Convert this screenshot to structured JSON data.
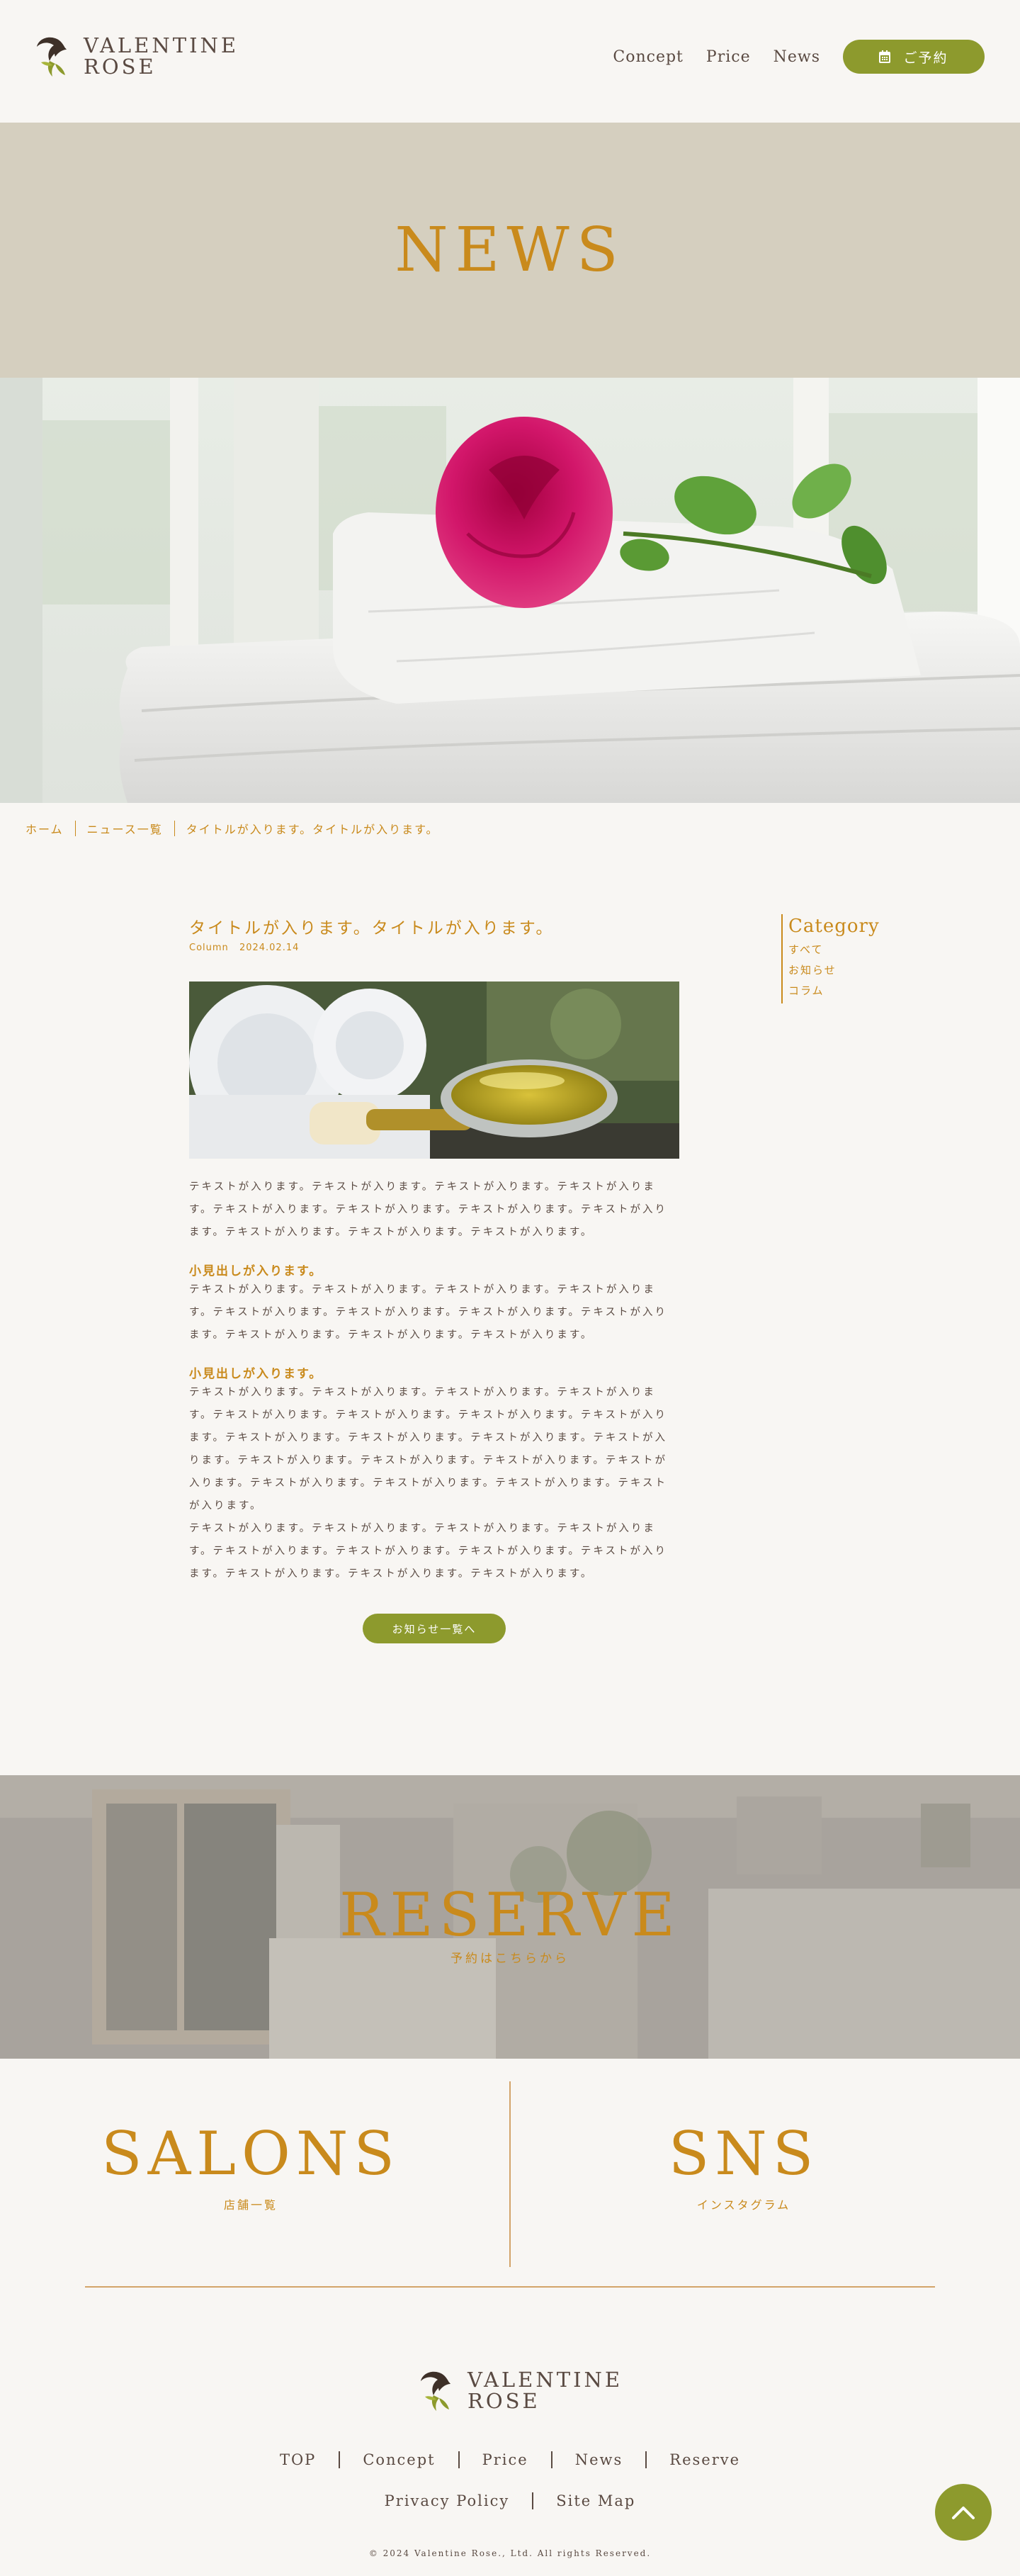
{
  "brand": {
    "line1": "VALENTINE",
    "line2": "ROSE"
  },
  "nav": {
    "items": [
      {
        "label": "Concept"
      },
      {
        "label": "Price"
      },
      {
        "label": "News"
      }
    ],
    "reserve_label": "ご予約"
  },
  "hero": {
    "title": "NEWS"
  },
  "breadcrumb": [
    "ホーム",
    "ニュース一覧",
    "タイトルが入ります。タイトルが入ります。"
  ],
  "article": {
    "title": "タイトルが入ります。タイトルが入ります。",
    "category": "Column",
    "date": "2024.02.14",
    "paragraph1": "テキストが入ります。テキストが入ります。テキストが入ります。テキストが入ります。テキストが入ります。テキストが入ります。テキストが入ります。テキストが入ります。テキストが入ります。テキストが入ります。テキストが入ります。",
    "subheading1": "小見出しが入ります。",
    "paragraph2": "テキストが入ります。テキストが入ります。テキストが入ります。テキストが入ります。テキストが入ります。テキストが入ります。テキストが入ります。テキストが入ります。テキストが入ります。テキストが入ります。テキストが入ります。",
    "subheading2": "小見出しが入ります。",
    "paragraph3": "テキストが入ります。テキストが入ります。テキストが入ります。テキストが入ります。テキストが入ります。テキストが入ります。テキストが入ります。テキストが入ります。テキストが入ります。テキストが入ります。テキストが入ります。テキストが入ります。テキストが入ります。テキストが入ります。テキストが入ります。テキストが入ります。テキストが入ります。テキストが入ります。テキストが入ります。テキストが入ります。",
    "paragraph4": "テキストが入ります。テキストが入ります。テキストが入ります。テキストが入ります。テキストが入ります。テキストが入ります。テキストが入ります。テキストが入ります。テキストが入ります。テキストが入ります。テキストが入ります。",
    "back_button": "お知らせ一覧へ"
  },
  "sidebar": {
    "title": "Category",
    "items": [
      "すべて",
      "お知らせ",
      "コラム"
    ]
  },
  "reserve": {
    "title": "RESERVE",
    "subtitle": "予約はこちらから"
  },
  "salons": {
    "title": "SALONS",
    "subtitle": "店舗一覧"
  },
  "sns": {
    "title": "SNS",
    "subtitle": "インスタグラム"
  },
  "footer": {
    "nav1": [
      "TOP",
      "Concept",
      "Price",
      "News",
      "Reserve"
    ],
    "nav2": [
      "Privacy Policy",
      "Site Map"
    ],
    "copyright": "© 2024 Valentine Rose., Ltd. All rights Reserved."
  },
  "colors": {
    "accent": "#c98a1c",
    "button": "#8d9a2d",
    "hero_band": "#d5cfbf",
    "background": "#f8f6f3",
    "text": "#5a4a42"
  },
  "icons": [
    "rose-logo-icon",
    "calendar-icon",
    "chevron-up-icon"
  ]
}
